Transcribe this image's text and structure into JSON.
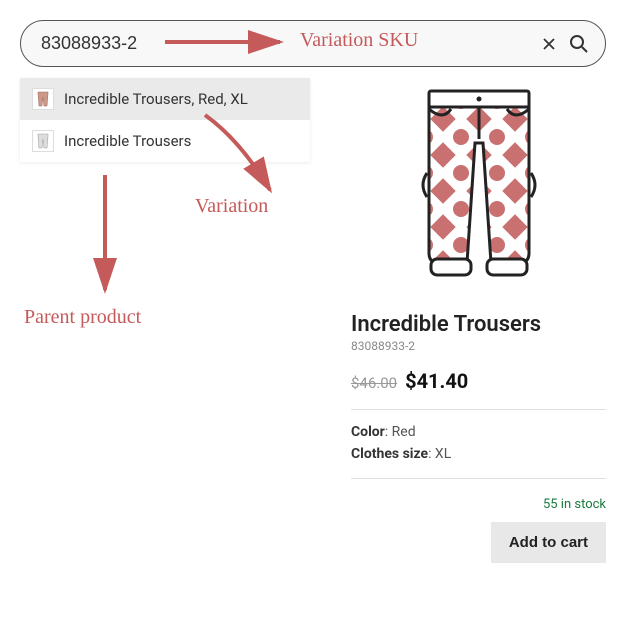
{
  "search": {
    "value": "83088933-2"
  },
  "dropdown": {
    "items": [
      {
        "label": "Incredible Trousers, Red, XL"
      },
      {
        "label": "Incredible Trousers"
      }
    ]
  },
  "product": {
    "title": "Incredible Trousers",
    "sku": "83088933-2",
    "price_old": "$46.00",
    "price_new": "$41.40",
    "attrs": {
      "color_label": "Color",
      "color_value": ": Red",
      "size_label": "Clothes size",
      "size_value": ": XL"
    },
    "stock": "55 in stock",
    "add_to_cart": "Add to cart"
  },
  "annotations": {
    "sku": "Variation SKU",
    "variation": "Variation",
    "parent": "Parent product"
  }
}
